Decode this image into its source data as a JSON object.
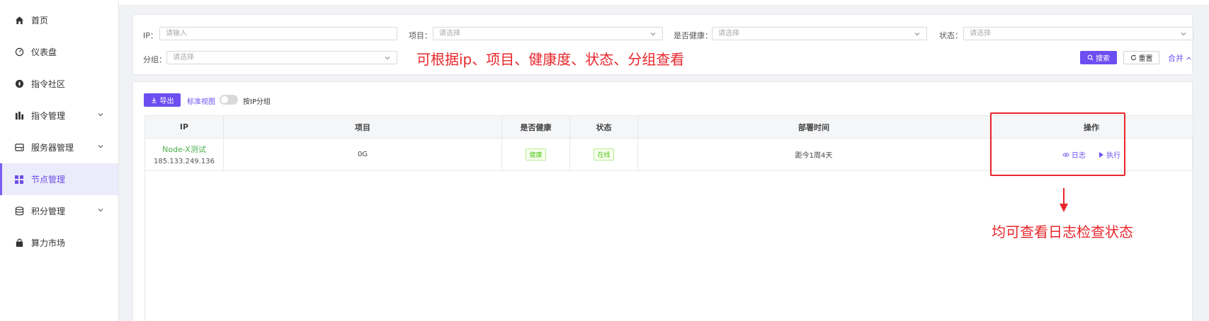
{
  "sidebar": {
    "items": [
      {
        "label": "首页",
        "icon": "home-icon",
        "chevron": false,
        "active": false
      },
      {
        "label": "仪表盘",
        "icon": "dashboard-icon",
        "chevron": false,
        "active": false
      },
      {
        "label": "指令社区",
        "icon": "compass-icon",
        "chevron": false,
        "active": false
      },
      {
        "label": "指令管理",
        "icon": "bar-chart-icon",
        "chevron": true,
        "active": false
      },
      {
        "label": "服务器管理",
        "icon": "server-icon",
        "chevron": true,
        "active": false
      },
      {
        "label": "节点管理",
        "icon": "grid-icon",
        "chevron": false,
        "active": true
      },
      {
        "label": "积分管理",
        "icon": "database-icon",
        "chevron": true,
        "active": false
      },
      {
        "label": "算力市场",
        "icon": "shopping-bag-icon",
        "chevron": false,
        "active": false
      }
    ]
  },
  "filters": {
    "ip_label": "IP：",
    "ip_placeholder": "请输入",
    "project_label": "项目：",
    "project_placeholder": "请选择",
    "health_label": "是否健康：",
    "health_placeholder": "请选择",
    "status_label": "状态：",
    "status_placeholder": "请选择",
    "group_label": "分组：",
    "group_placeholder": "请选择",
    "search_label": "搜索",
    "reset_label": "重置",
    "collapse_label": "合并"
  },
  "annotations": {
    "filter_note": "可根据ip、项目、健康度、状态、分组查看",
    "operation_note": "均可查看日志检查状态"
  },
  "toolbar": {
    "export_label": "导出",
    "standard_view_label": "标准视图",
    "group_by_ip_label": "按IP分组",
    "group_by_ip_enabled": false
  },
  "table": {
    "headers": {
      "ip": "IP",
      "project": "项目",
      "healthy": "是否健康",
      "status": "状态",
      "deploy_time": "部署时间",
      "operation": "操作"
    },
    "rows": [
      {
        "node_name": "Node-X测试",
        "ip": "185.133.249.136",
        "project": "0G",
        "healthy": "健康",
        "status": "在线",
        "deploy_time": "距今1周4天",
        "action_log": "日志",
        "action_exec": "执行"
      }
    ]
  },
  "colors": {
    "accent": "#6d4ef0",
    "annotation": "#e8262b",
    "success": "#52c41a"
  }
}
